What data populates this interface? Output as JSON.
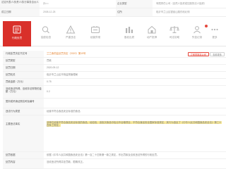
{
  "info_table": {
    "row1": {
      "label_left": "法定代表人/负责人/执行事务合伙人",
      "value_left": "孙□□",
      "label_right": "企业类型",
      "value_right": "有限责任公司（自然人投资或控股的法人独资）"
    },
    "row2": {
      "label_left": "成立日期",
      "value_left": "2008-12-28",
      "label_right": "住所",
      "value_right": "临沂市兰山区银雀山路东段北侧"
    }
  },
  "tabs": [
    {
      "label": "行政处罚",
      "icon": "penalty-icon",
      "active": true
    },
    {
      "label": "抽查检查",
      "icon": "inspection-icon",
      "active": false
    },
    {
      "label": "严重违法",
      "icon": "serious-violation-icon",
      "active": false
    },
    {
      "label": "经营异常",
      "icon": "abnormal-operation-icon",
      "active": false
    },
    {
      "label": "股权出质",
      "icon": "equity-pledge-icon",
      "active": false
    },
    {
      "label": "动产抵押",
      "icon": "mortgage-icon",
      "active": false
    },
    {
      "label": "司法协助",
      "icon": "judicial-icon",
      "active": false
    },
    {
      "label": "失信记录",
      "icon": "dishonest-icon",
      "active": false
    },
    {
      "label": "更多",
      "icon": "more-icon",
      "active": false
    }
  ],
  "detail": {
    "doc_no_label": "行政处罚决定书文号",
    "doc_no_value": "兰兰食药监处罚决定〔2020〕第19号",
    "btn_report": "立即举报本公司",
    "btn_more": "查看更多",
    "rows": [
      {
        "label": "处罚类型",
        "value": "罚款"
      },
      {
        "label": "处罚日期",
        "value": "2020-09-12"
      },
      {
        "label": "处罚机关",
        "value": "临沂市兰山区市场监督管理局"
      },
      {
        "label": "罚款金额（万元）",
        "value": "0.75"
      },
      {
        "label": "没收违法所得、没收非法财物的金额（万元）",
        "value": "0.2"
      },
      {
        "label": "暂扣或吊销证照名称及编号",
        "value": ""
      },
      {
        "label": "违法行为类型",
        "value": "经营不符合食品安全标准的食品"
      },
      {
        "label": "主要违法事实",
        "value": "该单位经营不符合食品安全标准的食品，经检验，该批次食品中检出不合格项目，不符合食品安全国家标准规定，其行为违反了《中华人民共和国食品安全法》第三十四条之规定。"
      },
      {
        "label": "处罚依据",
        "value": "依据《中华人民共和国食品安全法》第一百二十四条第一款之规定，作出罚款及没收违法所得的行政处罚。"
      },
      {
        "label": "处罚内容",
        "value": "没收违法所得并处罚款，限期改正。"
      }
    ]
  },
  "colors": {
    "accent": "#d9302a",
    "highlight": "#f7e89a",
    "label_bg": "#f7f7f7",
    "link_orange": "#e5822e"
  }
}
